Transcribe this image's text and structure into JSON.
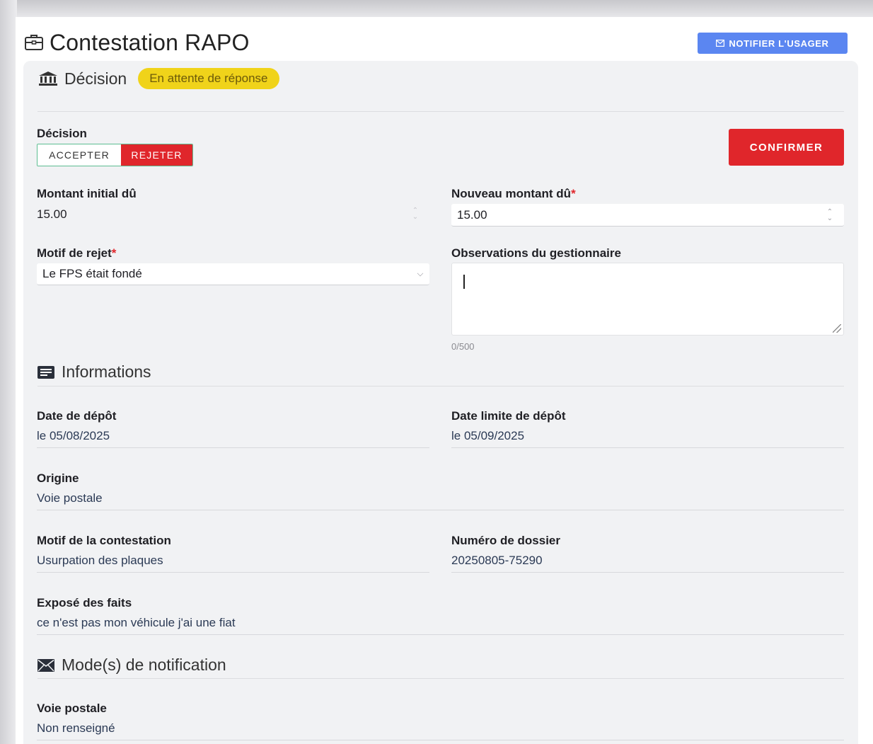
{
  "header": {
    "title": "Contestation RAPO",
    "notify_label": "NOTIFIER L'USAGER"
  },
  "decision_section": {
    "title": "Décision",
    "status_badge": "En attente de réponse",
    "decision_label": "Décision",
    "accept_label": "ACCEPTER",
    "reject_label": "REJETER",
    "selected": "REJETER",
    "confirm_label": "CONFIRMER",
    "initial_amount_label": "Montant initial dû",
    "initial_amount_value": "15.00",
    "new_amount_label": "Nouveau montant dû",
    "new_amount_value": "15.00",
    "reject_reason_label": "Motif de rejet",
    "reject_reason_value": "Le FPS était fondé",
    "observations_label": "Observations du gestionnaire",
    "observations_value": "",
    "observations_counter": "0/500",
    "required_mark": "*"
  },
  "info_section": {
    "title": "Informations",
    "deposit_date_label": "Date de dépôt",
    "deposit_date_value": "le 05/08/2025",
    "deadline_label": "Date limite de dépôt",
    "deadline_value": "le 05/09/2025",
    "origin_label": "Origine",
    "origin_value": "Voie postale",
    "reason_label": "Motif de la contestation",
    "reason_value": "Usurpation des plaques",
    "file_number_label": "Numéro de dossier",
    "file_number_value": "20250805-75290",
    "facts_label": "Exposé des faits",
    "facts_value": "ce n'est pas mon véhicule j'ai une fiat"
  },
  "notification_section": {
    "title": "Mode(s) de notification",
    "postal_label": "Voie postale",
    "postal_value": "Non renseigné"
  },
  "colors": {
    "primary": "#5b86f1",
    "danger": "#e0262b",
    "warning": "#f0d31a",
    "success_border": "#5cbd91"
  }
}
